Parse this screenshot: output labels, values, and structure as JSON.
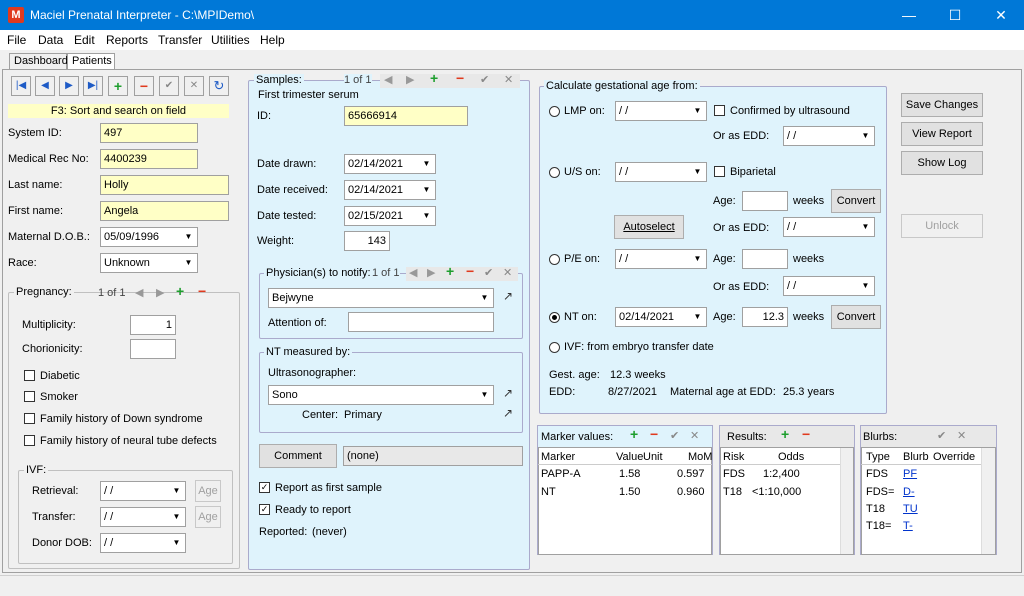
{
  "app": {
    "title": "Maciel Prenatal Interpreter - C:\\MPIDemo\\",
    "icon_letter": "M"
  },
  "window": {
    "minimize": "—",
    "maximize": "☐",
    "close": "✕"
  },
  "menu": [
    "File",
    "Data",
    "Edit",
    "Reports",
    "Transfer",
    "Utilities",
    "Help"
  ],
  "tabs": [
    "Dashboard",
    "Patients"
  ],
  "toolbar": {
    "first": "|◀",
    "prev": "◀",
    "next": "▶",
    "last": "▶|",
    "add": "+",
    "remove": "−",
    "ok": "✔",
    "cancel": "✕",
    "refresh": "↻"
  },
  "hint": "F3: Sort and search on field",
  "patient": {
    "system_id_label": "System ID:",
    "system_id": "497",
    "medrec_label": "Medical Rec No:",
    "medrec": "4400239",
    "last_label": "Last name:",
    "last": "Holly",
    "first_label": "First name:",
    "first": "Angela",
    "dob_label": "Maternal D.O.B.:",
    "dob": "05/09/1996",
    "race_label": "Race:",
    "race": "Unknown"
  },
  "pregnancy": {
    "label": "Pregnancy:",
    "pager": "1 of 1",
    "multiplicity_label": "Multiplicity:",
    "multiplicity": "1",
    "chorionicity_label": "Chorionicity:",
    "chorionicity": "",
    "diabetic": "Diabetic",
    "smoker": "Smoker",
    "down": "Family history of Down syndrome",
    "ntd": "Family history of neural tube defects",
    "ivf_label": "IVF:",
    "retrieval_label": "Retrieval:",
    "retrieval": "/ /",
    "transfer_label": "Transfer:",
    "transfer": "/ /",
    "donor_label": "Donor DOB:",
    "donor": "/ /",
    "age_btn": "Age"
  },
  "samples": {
    "label": "Samples:",
    "pager": "1 of 1",
    "type": "First trimester serum",
    "id_label": "ID:",
    "id": "65666914",
    "drawn_label": "Date drawn:",
    "drawn": "02/14/2021",
    "received_label": "Date received:",
    "received": "02/14/2021",
    "tested_label": "Date tested:",
    "tested": "02/15/2021",
    "weight_label": "Weight:",
    "weight": "143",
    "physician_label": "Physician(s) to notify:",
    "physician_pager": "1 of 1",
    "physician": "Bejwyne",
    "attention_label": "Attention of:",
    "attention": "",
    "nt_label": "NT measured by:",
    "sono_label": "Ultrasonographer:",
    "sono": "Sono",
    "center_label": "Center:",
    "center": "Primary",
    "comment_btn": "Comment",
    "comment": "(none)",
    "first_sample": "Report as first sample",
    "ready": "Ready to report",
    "reported_label": "Reported:",
    "reported": "(never)"
  },
  "gest": {
    "label": "Calculate gestational age from:",
    "lmp_label": "LMP on:",
    "lmp": "/ /",
    "confirmed": "Confirmed by ultrasound",
    "edd_label": "Or as EDD:",
    "edd_val": "/ /",
    "us_label": "U/S on:",
    "us": "/ /",
    "biparietal": "Biparietal",
    "age_label": "Age:",
    "weeks": "weeks",
    "convert": "Convert",
    "autoselect": "Autoselect",
    "pe_label": "P/E on:",
    "pe": "/ /",
    "nt_label": "NT on:",
    "nt_date": "02/14/2021",
    "nt_age": "12.3",
    "ivf_label": "IVF: from embryo transfer date",
    "gest_age_label": "Gest. age:",
    "gest_age": "12.3 weeks",
    "edd2_label": "EDD:",
    "edd2": "8/27/2021",
    "mat_age_label": "Maternal age at EDD:",
    "mat_age": "25.3 years"
  },
  "actions": {
    "save": "Save Changes",
    "view": "View Report",
    "log": "Show Log",
    "unlock": "Unlock"
  },
  "markers": {
    "label": "Marker values:",
    "headers": [
      "Marker",
      "Value",
      "Unit",
      "MoM"
    ],
    "rows": [
      [
        "PAPP-A",
        "1.58",
        "",
        "0.597"
      ],
      [
        "NT",
        "1.50",
        "",
        "0.960"
      ]
    ]
  },
  "results": {
    "label": "Results:",
    "headers": [
      "Risk",
      "Odds"
    ],
    "rows": [
      [
        "FDS",
        "1:2,400"
      ],
      [
        "T18",
        "<1:10,000"
      ]
    ]
  },
  "blurbs": {
    "label": "Blurbs:",
    "headers": [
      "Type",
      "Blurb",
      "Override"
    ],
    "rows": [
      [
        "FDS",
        "PF"
      ],
      [
        "FDS=",
        "D-"
      ],
      [
        "T18",
        "TU"
      ],
      [
        "T18=",
        "T-"
      ]
    ]
  }
}
